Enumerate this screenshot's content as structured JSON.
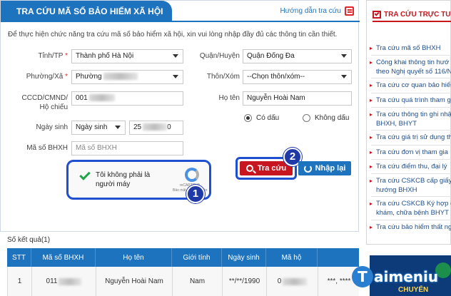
{
  "panel": {
    "title": "TRA CỨU MÃ SỐ BẢO HIỂM XÃ HỘI",
    "guide_link": "Hướng dẫn tra cứu",
    "intro": "Để thực hiện chức năng tra cứu mã số bảo hiểm xã hội, xin vui lòng nhập đầy đủ các thông tin cần thiết."
  },
  "form": {
    "province_label": "Tỉnh/TP",
    "province_value": "Thành phố Hà Nội",
    "district_label": "Quận/Huyện",
    "district_value": "Quận Đống Đa",
    "ward_label": "Phường/Xã",
    "ward_value": "Phường",
    "village_label": "Thôn/Xóm",
    "village_value": "--Chọn thôn/xóm--",
    "id_label_1": "CCCD/CMND/",
    "id_label_2": "Hộ chiếu",
    "id_value": "001",
    "name_label": "Họ tên",
    "name_value": "Nguyễn Hoài Nam",
    "accent_yes": "Có dấu",
    "accent_no": "Không dấu",
    "dob_label": "Ngày sinh",
    "dob_type_value": "Ngày sinh",
    "dob_value_start": "25",
    "dob_value_end": "0",
    "bhxh_label": "Mã số BHXH",
    "bhxh_placeholder": "Mã số BHXH",
    "required_mark": "*"
  },
  "captcha": {
    "text": "Tôi không phải là người máy",
    "brand": "reCAPTCHA",
    "links": "Bảo mật - Điều khoản"
  },
  "badges": {
    "one": "1",
    "two": "2"
  },
  "buttons": {
    "search": "Tra cứu",
    "reset": "Nhập lại"
  },
  "results": {
    "count_label": "Số kết quả(1)",
    "columns": [
      "STT",
      "Mã số BHXH",
      "Họ tên",
      "Giới tính",
      "Ngày sinh",
      "Mã hộ",
      ""
    ],
    "rows": [
      [
        "1",
        "011",
        "Nguyễn Hoài Nam",
        "Nam",
        "**/**/1990",
        "0",
        "***, ****"
      ]
    ]
  },
  "sidebar": {
    "title": "TRA CỨU TRỰC TUYẾN",
    "items": [
      [
        "Tra cứu mã số BHXH"
      ],
      [
        "Công khai thông tin hướ",
        "theo Nghị quyết số 116/N"
      ],
      [
        "Tra cứu cơ quan bảo hiểm"
      ],
      [
        "Tra cứu quá trình tham g"
      ],
      [
        "Tra cứu thông tin ghi nhậ",
        "BHXH, BHYT"
      ],
      [
        "Tra cứu giá trị sử dụng th"
      ],
      [
        "Tra cứu đơn vị tham gia"
      ],
      [
        "Tra cứu điểm thu, đại lý"
      ],
      [
        "Tra cứu CSKCB cấp giấy",
        "hướng BHXH"
      ],
      [
        "Tra cứu CSKCB Ký hợp đ",
        "khám, chữa bệnh BHYT"
      ],
      [
        "Tra cứu bảo hiểm thất ng"
      ]
    ]
  },
  "ad": {
    "text": "CHUYỂN"
  },
  "watermark": {
    "text": "aimeniu",
    "letter": "T"
  }
}
